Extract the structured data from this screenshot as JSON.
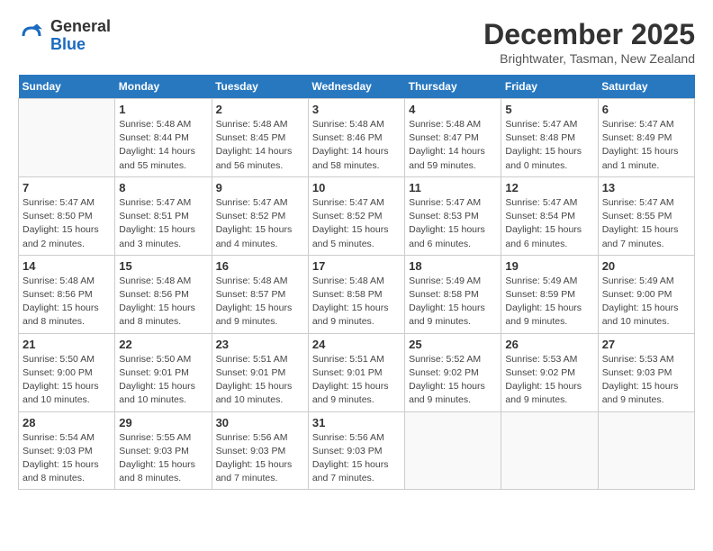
{
  "header": {
    "logo_general": "General",
    "logo_blue": "Blue",
    "month_title": "December 2025",
    "location": "Brightwater, Tasman, New Zealand"
  },
  "weekdays": [
    "Sunday",
    "Monday",
    "Tuesday",
    "Wednesday",
    "Thursday",
    "Friday",
    "Saturday"
  ],
  "weeks": [
    [
      {
        "day": "",
        "info": ""
      },
      {
        "day": "1",
        "info": "Sunrise: 5:48 AM\nSunset: 8:44 PM\nDaylight: 14 hours\nand 55 minutes."
      },
      {
        "day": "2",
        "info": "Sunrise: 5:48 AM\nSunset: 8:45 PM\nDaylight: 14 hours\nand 56 minutes."
      },
      {
        "day": "3",
        "info": "Sunrise: 5:48 AM\nSunset: 8:46 PM\nDaylight: 14 hours\nand 58 minutes."
      },
      {
        "day": "4",
        "info": "Sunrise: 5:48 AM\nSunset: 8:47 PM\nDaylight: 14 hours\nand 59 minutes."
      },
      {
        "day": "5",
        "info": "Sunrise: 5:47 AM\nSunset: 8:48 PM\nDaylight: 15 hours\nand 0 minutes."
      },
      {
        "day": "6",
        "info": "Sunrise: 5:47 AM\nSunset: 8:49 PM\nDaylight: 15 hours\nand 1 minute."
      }
    ],
    [
      {
        "day": "7",
        "info": "Sunrise: 5:47 AM\nSunset: 8:50 PM\nDaylight: 15 hours\nand 2 minutes."
      },
      {
        "day": "8",
        "info": "Sunrise: 5:47 AM\nSunset: 8:51 PM\nDaylight: 15 hours\nand 3 minutes."
      },
      {
        "day": "9",
        "info": "Sunrise: 5:47 AM\nSunset: 8:52 PM\nDaylight: 15 hours\nand 4 minutes."
      },
      {
        "day": "10",
        "info": "Sunrise: 5:47 AM\nSunset: 8:52 PM\nDaylight: 15 hours\nand 5 minutes."
      },
      {
        "day": "11",
        "info": "Sunrise: 5:47 AM\nSunset: 8:53 PM\nDaylight: 15 hours\nand 6 minutes."
      },
      {
        "day": "12",
        "info": "Sunrise: 5:47 AM\nSunset: 8:54 PM\nDaylight: 15 hours\nand 6 minutes."
      },
      {
        "day": "13",
        "info": "Sunrise: 5:47 AM\nSunset: 8:55 PM\nDaylight: 15 hours\nand 7 minutes."
      }
    ],
    [
      {
        "day": "14",
        "info": "Sunrise: 5:48 AM\nSunset: 8:56 PM\nDaylight: 15 hours\nand 8 minutes."
      },
      {
        "day": "15",
        "info": "Sunrise: 5:48 AM\nSunset: 8:56 PM\nDaylight: 15 hours\nand 8 minutes."
      },
      {
        "day": "16",
        "info": "Sunrise: 5:48 AM\nSunset: 8:57 PM\nDaylight: 15 hours\nand 9 minutes."
      },
      {
        "day": "17",
        "info": "Sunrise: 5:48 AM\nSunset: 8:58 PM\nDaylight: 15 hours\nand 9 minutes."
      },
      {
        "day": "18",
        "info": "Sunrise: 5:49 AM\nSunset: 8:58 PM\nDaylight: 15 hours\nand 9 minutes."
      },
      {
        "day": "19",
        "info": "Sunrise: 5:49 AM\nSunset: 8:59 PM\nDaylight: 15 hours\nand 9 minutes."
      },
      {
        "day": "20",
        "info": "Sunrise: 5:49 AM\nSunset: 9:00 PM\nDaylight: 15 hours\nand 10 minutes."
      }
    ],
    [
      {
        "day": "21",
        "info": "Sunrise: 5:50 AM\nSunset: 9:00 PM\nDaylight: 15 hours\nand 10 minutes."
      },
      {
        "day": "22",
        "info": "Sunrise: 5:50 AM\nSunset: 9:01 PM\nDaylight: 15 hours\nand 10 minutes."
      },
      {
        "day": "23",
        "info": "Sunrise: 5:51 AM\nSunset: 9:01 PM\nDaylight: 15 hours\nand 10 minutes."
      },
      {
        "day": "24",
        "info": "Sunrise: 5:51 AM\nSunset: 9:01 PM\nDaylight: 15 hours\nand 9 minutes."
      },
      {
        "day": "25",
        "info": "Sunrise: 5:52 AM\nSunset: 9:02 PM\nDaylight: 15 hours\nand 9 minutes."
      },
      {
        "day": "26",
        "info": "Sunrise: 5:53 AM\nSunset: 9:02 PM\nDaylight: 15 hours\nand 9 minutes."
      },
      {
        "day": "27",
        "info": "Sunrise: 5:53 AM\nSunset: 9:03 PM\nDaylight: 15 hours\nand 9 minutes."
      }
    ],
    [
      {
        "day": "28",
        "info": "Sunrise: 5:54 AM\nSunset: 9:03 PM\nDaylight: 15 hours\nand 8 minutes."
      },
      {
        "day": "29",
        "info": "Sunrise: 5:55 AM\nSunset: 9:03 PM\nDaylight: 15 hours\nand 8 minutes."
      },
      {
        "day": "30",
        "info": "Sunrise: 5:56 AM\nSunset: 9:03 PM\nDaylight: 15 hours\nand 7 minutes."
      },
      {
        "day": "31",
        "info": "Sunrise: 5:56 AM\nSunset: 9:03 PM\nDaylight: 15 hours\nand 7 minutes."
      },
      {
        "day": "",
        "info": ""
      },
      {
        "day": "",
        "info": ""
      },
      {
        "day": "",
        "info": ""
      }
    ]
  ]
}
